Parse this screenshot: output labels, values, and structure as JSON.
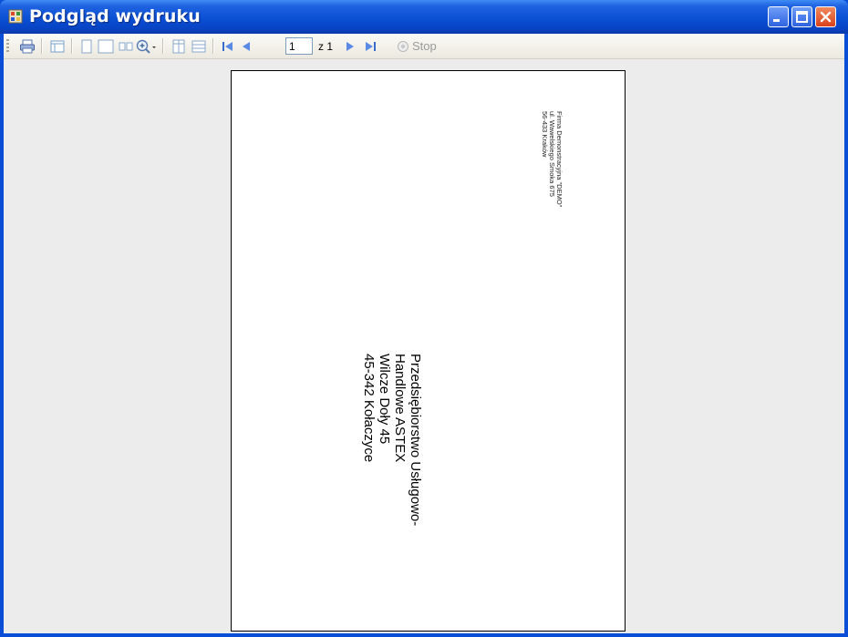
{
  "window": {
    "title": "Podgląd wydruku"
  },
  "toolbar": {
    "current_page": "1",
    "of_label": "z 1",
    "stop_label": "Stop",
    "buttons": [
      "print-icon",
      "page-setup-icon",
      "one-page-icon",
      "two-pages-icon",
      "four-pages-icon",
      "zoom-icon",
      "columns-icon",
      "rows-icon",
      "first-page-icon",
      "previous-page-icon",
      "next-page-icon",
      "last-page-icon",
      "stop-icon"
    ]
  },
  "document": {
    "sender": {
      "line1": "Firma Demonstracyjna \"DEMO\"",
      "line2": "ul. Wawelskiego Smoka 675",
      "line3": "56-433 Kraków"
    },
    "recipient": {
      "line1": "Przedsiębiorstwo Usługowo-",
      "line2": "Handlowe ASTEX",
      "line3": "Wilcze Doły 45",
      "line4": "45-342 Kołaczyce"
    }
  },
  "colors": {
    "titlebar": "#0a4fd4",
    "close": "#d9411b",
    "frame": "#ececec"
  }
}
